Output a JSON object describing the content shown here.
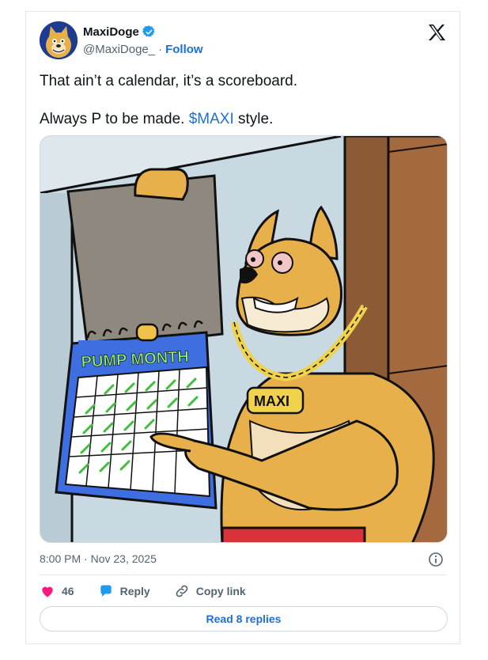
{
  "author": {
    "display_name": "MaxiDoge",
    "handle": "@MaxiDoge_",
    "separator": "·",
    "follow_label": "Follow"
  },
  "tweet": {
    "line1": "That ain’t a calendar, it’s a scoreboard.",
    "line2_prefix": "Always P to be made. ",
    "cashtag": "$MAXI",
    "line2_suffix": " style."
  },
  "image_text": {
    "calendar_title": "PUMP MONTH",
    "chain_tag": "MAXI"
  },
  "meta": {
    "timestamp": "8:00 PM · Nov 23, 2025"
  },
  "actions": {
    "like_count": "46",
    "reply_label": "Reply",
    "copy_link_label": "Copy link"
  },
  "replies_button": "Read 8 replies",
  "icons": {
    "verified": "verified-badge-icon",
    "brand": "x-logo-icon",
    "info": "info-icon",
    "like": "heart-icon",
    "reply": "reply-bubble-icon",
    "link": "link-icon"
  },
  "colors": {
    "accent": "#1d6fd8",
    "heart": "#f91880",
    "muted": "#536471"
  }
}
